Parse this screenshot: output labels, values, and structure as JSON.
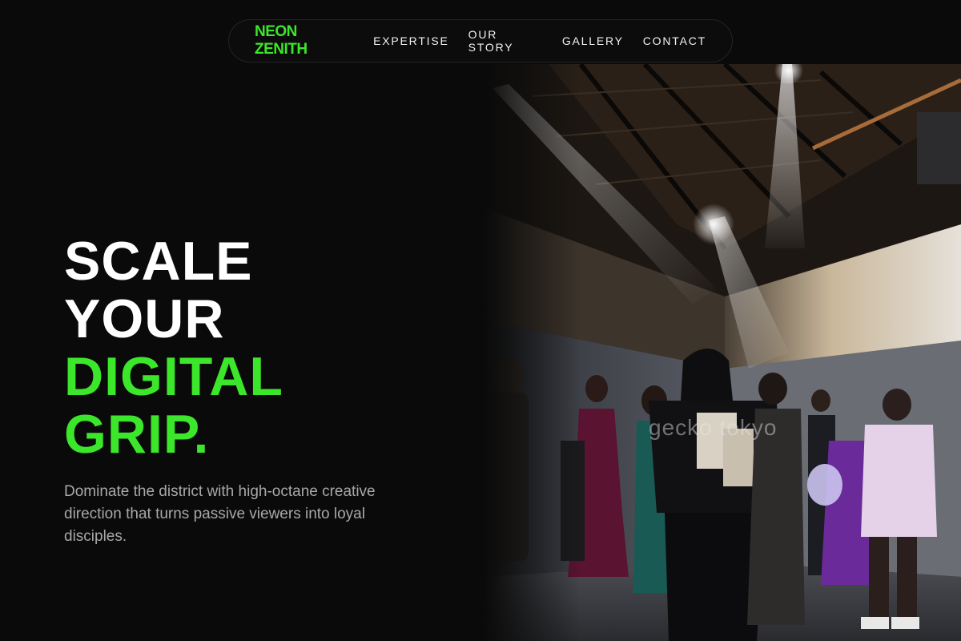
{
  "nav": {
    "brand": "NEON ZENITH",
    "links": [
      "EXPERTISE",
      "OUR STORY",
      "GALLERY",
      "CONTACT"
    ]
  },
  "hero": {
    "title_lines": [
      "SCALE",
      "YOUR",
      "DIGITAL",
      "GRIP."
    ],
    "subtitle": "Dominate the district with high-octane creative direction that turns passive viewers into loyal disciples.",
    "image_watermark": "gecko tokyo"
  },
  "colors": {
    "accent": "#3ce62a",
    "background": "#0a0a0a",
    "text": "#ffffff",
    "muted": "#a8a8a8"
  }
}
